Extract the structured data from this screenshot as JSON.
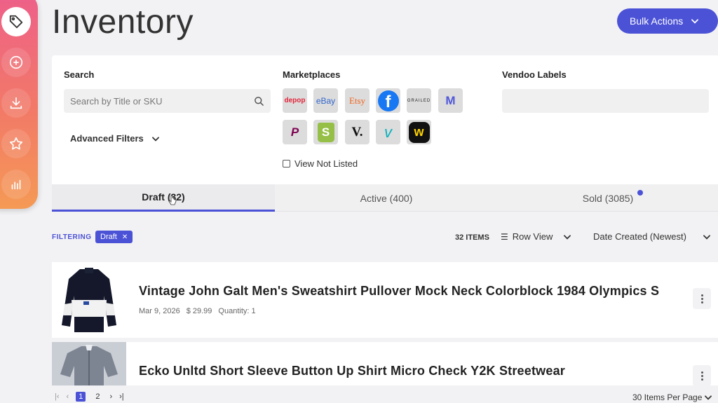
{
  "page": {
    "title": "Inventory"
  },
  "sidebar": {
    "items": [
      "tag-icon",
      "plus-circle-icon",
      "download-icon",
      "star-icon",
      "bar-chart-icon"
    ]
  },
  "header": {
    "bulk_actions": "Bulk Actions"
  },
  "filters": {
    "search_label": "Search",
    "search_placeholder": "Search by Title or SKU",
    "advanced_filters": "Advanced Filters",
    "marketplaces_label": "Marketplaces",
    "view_not_listed": "View Not Listed",
    "vendoo_labels": "Vendoo Labels",
    "marketplaces": [
      {
        "name": "depop",
        "text": "depop",
        "color": "#e3263b"
      },
      {
        "name": "ebay",
        "text": "eBay",
        "color": "#3366cc"
      },
      {
        "name": "etsy",
        "text": "Etsy",
        "color": "#f1641e"
      },
      {
        "name": "facebook",
        "text": "f",
        "color": "#1877f2"
      },
      {
        "name": "grailed",
        "text": "GRAILED",
        "color": "#222222"
      },
      {
        "name": "mercari",
        "text": "M",
        "color": "#5058d8"
      },
      {
        "name": "poshmark",
        "text": "P",
        "color": "#7f0353"
      },
      {
        "name": "shopify",
        "text": "S",
        "color": "#95bf47"
      },
      {
        "name": "vestiaire",
        "text": "V.",
        "color": "#111111"
      },
      {
        "name": "vinted",
        "text": "v",
        "color": "#09b1ba"
      },
      {
        "name": "whatnot",
        "text": "w",
        "color": "#ffd400"
      }
    ]
  },
  "tabs": [
    {
      "label": "Draft (32)"
    },
    {
      "label": "Active (400)"
    },
    {
      "label": "Sold (3085)"
    }
  ],
  "list_controls": {
    "filtering_label": "FILTERING",
    "chip": "Draft",
    "chip_close": "✕",
    "items_count": "32 ITEMS",
    "row_view": "Row View",
    "sort": "Date Created (Newest)"
  },
  "listings": [
    {
      "title": "Vintage John Galt Men's Sweatshirt Pullover Mock Neck Colorblock 1984 Olympics S",
      "date": "Mar 9, 2026",
      "price": "$ 29.99",
      "quantity": "Quantity: 1"
    },
    {
      "title": "Ecko Unltd Short Sleeve Button Up Shirt Micro Check Y2K Streetwear"
    }
  ],
  "pagination": {
    "first": "|‹",
    "prev": "‹",
    "pages": [
      "1",
      "2"
    ],
    "next": "›",
    "last": "›|",
    "per_page": "30 Items Per Page"
  },
  "colors": {
    "accent": "#4b52d6",
    "sidebar_top": "#ee5f8a",
    "sidebar_bottom": "#f59a55"
  }
}
